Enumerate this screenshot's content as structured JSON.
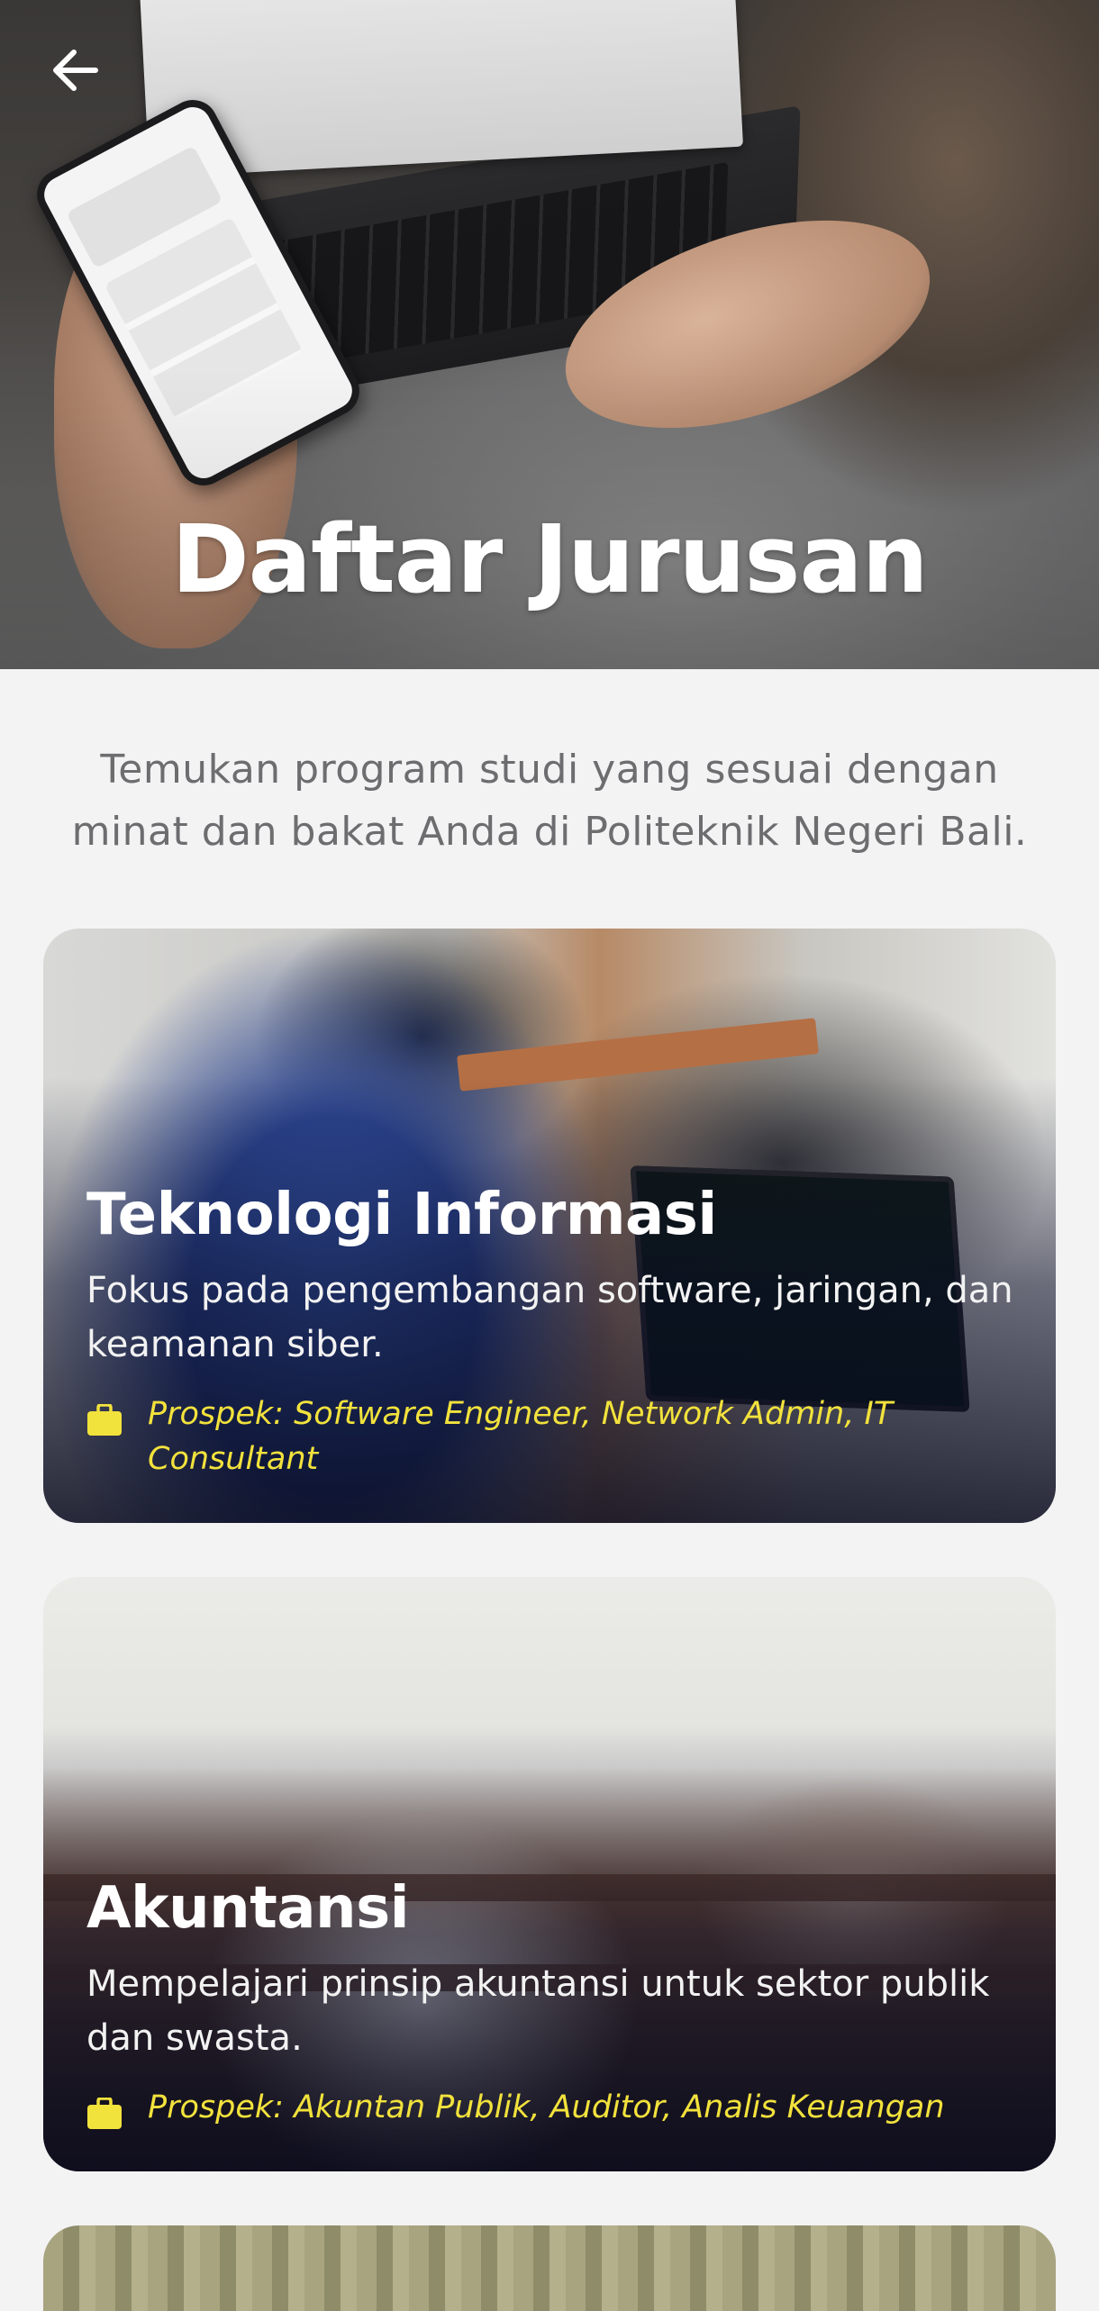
{
  "header": {
    "title": "Daftar Jurusan",
    "back_icon": "arrow-left-icon"
  },
  "intro": {
    "text": "Temukan program studi yang sesuai dengan minat dan bakat Anda di Politeknik Negeri Bali."
  },
  "programs": [
    {
      "title": "Teknologi Informasi",
      "description": "Fokus pada pengembangan software, jaringan, dan keamanan siber.",
      "prospect": "Prospek: Software Engineer, Network Admin, IT Consultant",
      "icon": "briefcase-icon"
    },
    {
      "title": "Akuntansi",
      "description": "Mempelajari prinsip akuntansi untuk sektor publik dan swasta.",
      "prospect": "Prospek: Akuntan Publik, Auditor, Analis Keuangan",
      "icon": "briefcase-icon"
    }
  ],
  "colors": {
    "background": "#f3f3f4",
    "prospect_text": "#f2e23c",
    "intro_text": "#6d6d70",
    "title_text": "#ffffff"
  }
}
